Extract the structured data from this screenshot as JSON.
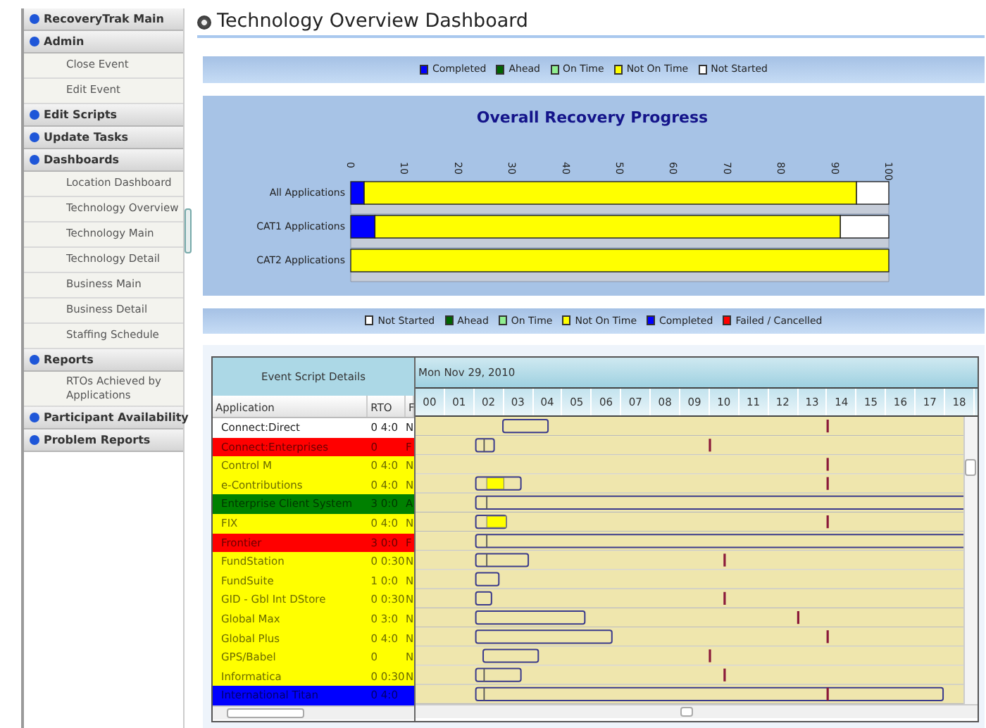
{
  "sidebar": {
    "sections": [
      {
        "label": "RecoveryTrak Main"
      },
      {
        "label": "Admin",
        "items": [
          "Close Event",
          "Edit Event"
        ]
      },
      {
        "label": "Edit Scripts"
      },
      {
        "label": "Update Tasks"
      },
      {
        "label": "Dashboards",
        "items": [
          "Location Dashboard",
          "Technology Overview",
          "Technology Main",
          "Technology Detail",
          "Business Main",
          "Business Detail",
          "Staffing Schedule"
        ]
      },
      {
        "label": "Reports",
        "items": [
          "RTOs Achieved by Applications"
        ]
      },
      {
        "label": "Participant Availability"
      },
      {
        "label": "Problem Reports"
      }
    ]
  },
  "page": {
    "title": "Technology Overview Dashboard"
  },
  "progress_chart": {
    "chart_data": {
      "type": "bar",
      "orientation": "horizontal",
      "stacked": true,
      "title": "Overall Recovery Progress",
      "categories": [
        "All Applications",
        "CAT1 Applications",
        "CAT2 Applications"
      ],
      "series": [
        {
          "name": "Completed",
          "color": "#0000ff",
          "values": [
            2.5,
            4.5,
            0
          ]
        },
        {
          "name": "Ahead",
          "color": "#006400",
          "values": [
            0,
            0,
            0
          ]
        },
        {
          "name": "On Time",
          "color": "#90ee90",
          "values": [
            0,
            0,
            0
          ]
        },
        {
          "name": "Not On Time",
          "color": "#ffff00",
          "values": [
            91.5,
            86.5,
            100
          ]
        },
        {
          "name": "Not Started",
          "color": "#ffffff",
          "values": [
            6,
            9,
            0
          ]
        }
      ],
      "xlim": [
        0,
        100
      ],
      "xticks": [
        0,
        10,
        20,
        30,
        40,
        50,
        60,
        70,
        80,
        90,
        100
      ]
    }
  },
  "gantt_legend": [
    {
      "label": "Not Started",
      "color": "#ffffff"
    },
    {
      "label": "Ahead",
      "color": "#006400"
    },
    {
      "label": "On Time",
      "color": "#90ee90"
    },
    {
      "label": "Not On Time",
      "color": "#ffff00"
    },
    {
      "label": "Completed",
      "color": "#0000ff"
    },
    {
      "label": "Failed / Cancelled",
      "color": "#ff0000"
    }
  ],
  "gantt": {
    "grid_title": "Event Script Details",
    "columns": [
      "Application",
      "RTO",
      "F"
    ],
    "date": "Mon Nov 29, 2010",
    "hours": [
      "00",
      "01",
      "02",
      "03",
      "04",
      "05",
      "06",
      "07",
      "08",
      "09",
      "10",
      "11",
      "12",
      "13",
      "14",
      "15",
      "16",
      "17",
      "18"
    ],
    "rows": [
      {
        "application": "Connect:Direct",
        "rto": "0 4:0",
        "column_3": "N",
        "color": "#ffffff"
      },
      {
        "application": "Connect:Enterprises",
        "rto": "0",
        "column_3": "F",
        "color": "#ff0000"
      },
      {
        "application": "Control M",
        "rto": "0 4:0",
        "column_3": "N",
        "color": "#ffff00"
      },
      {
        "application": "e-Contributions",
        "rto": "0 4:0",
        "column_3": "N",
        "color": "#ffff00"
      },
      {
        "application": "Enterprise Client System",
        "rto": "3 0:0",
        "column_3": "A",
        "color": "#008000"
      },
      {
        "application": "FIX",
        "rto": "0 4:0",
        "column_3": "N",
        "color": "#ffff00"
      },
      {
        "application": "Frontier",
        "rto": "3 0:0",
        "column_3": "F",
        "color": "#ff0000"
      },
      {
        "application": "FundStation",
        "rto": "0 0:30",
        "column_3": "N",
        "color": "#ffff00"
      },
      {
        "application": "FundSuite",
        "rto": "1 0:0",
        "column_3": "N",
        "color": "#ffff00"
      },
      {
        "application": "GID - Gbl Int DStore",
        "rto": "0 0:30",
        "column_3": "N",
        "color": "#ffff00"
      },
      {
        "application": "Global Max",
        "rto": "0 3:0",
        "column_3": "N",
        "color": "#ffff00"
      },
      {
        "application": "Global Plus",
        "rto": "0 4:0",
        "column_3": "N",
        "color": "#ffff00"
      },
      {
        "application": "GPS/Babel",
        "rto": "0",
        "column_3": "N",
        "color": "#ffff00"
      },
      {
        "application": "Informatica",
        "rto": "0 0:30",
        "column_3": "N",
        "color": "#ffff00"
      },
      {
        "application": "International Titan",
        "rto": "0 4:0",
        "color": "#0000ff"
      }
    ]
  }
}
